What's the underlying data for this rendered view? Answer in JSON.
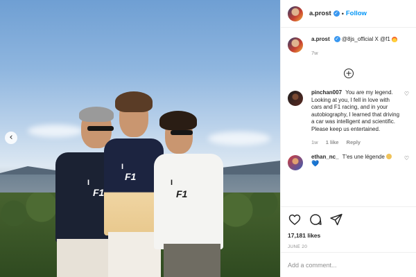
{
  "post": {
    "username": "a.prost",
    "follow_label": "Follow",
    "separator": "•"
  },
  "caption": {
    "username": "a.prost",
    "text": "@8js_official X @f1",
    "time": "7w"
  },
  "comments": [
    {
      "username": "pinchan007",
      "text": "You are my legend. Looking at you, I fell in love with cars and F1 racing, and in your autobiography, I learned that driving a car was intelligent and scientific. Please keep us entertained.",
      "time": "1w",
      "likes": "1 like",
      "reply_label": "Reply"
    },
    {
      "username": "ethan_nc_",
      "text": "T'es une légende",
      "heart": "💙"
    }
  ],
  "likes": "17,181 likes",
  "date": "JUNE 20",
  "add_comment_placeholder": "Add a comment...",
  "photo": {
    "shirt_text_left": "I",
    "shirt_brand": "F1",
    "carousel_prev": "‹"
  },
  "icons": {
    "like": "heart-icon",
    "comment": "comment-icon",
    "share": "share-icon",
    "load_more": "plus-circle-icon",
    "verified": "verified-badge-icon"
  },
  "colors": {
    "link_blue": "#0095f6",
    "verified_blue": "#3897f0",
    "muted": "#8e8e8e"
  }
}
